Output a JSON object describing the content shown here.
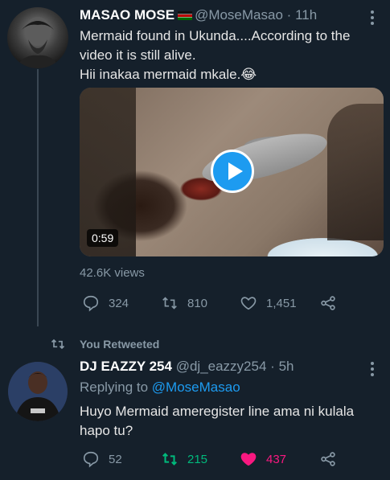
{
  "tweet1": {
    "author_name": "MASAO MOSE",
    "author_handle": "@MoseMasao",
    "separator": "·",
    "time": "11h",
    "text_line1": "Mermaid found in Ukunda....According to the",
    "text_line2": "video it is still alive.",
    "text_line3": "Hii inakaa mermaid mkale.😂",
    "video_duration": "0:59",
    "views": "42.6K views",
    "replies": "324",
    "retweets": "810",
    "likes": "1,451",
    "more_icon": "more-vertical-icon",
    "flag_icon": "kenya-flag-icon"
  },
  "retweet_context": {
    "label": "You Retweeted"
  },
  "tweet2": {
    "author_name": "DJ EAZZY 254",
    "author_handle": "@dj_eazzy254",
    "separator": "·",
    "time": "5h",
    "replying_prefix": "Replying to",
    "replying_handle": "@MoseMasao",
    "text_line1": "Huyo Mermaid ameregister line ama ni kulala",
    "text_line2": "hapo tu?",
    "replies": "52",
    "retweets": "215",
    "likes": "437",
    "retweeted_color": "#00ba7c",
    "liked_color": "#f91880"
  },
  "colors": {
    "background": "#15202b",
    "muted": "#8899a6",
    "accent": "#1d9bf0"
  }
}
